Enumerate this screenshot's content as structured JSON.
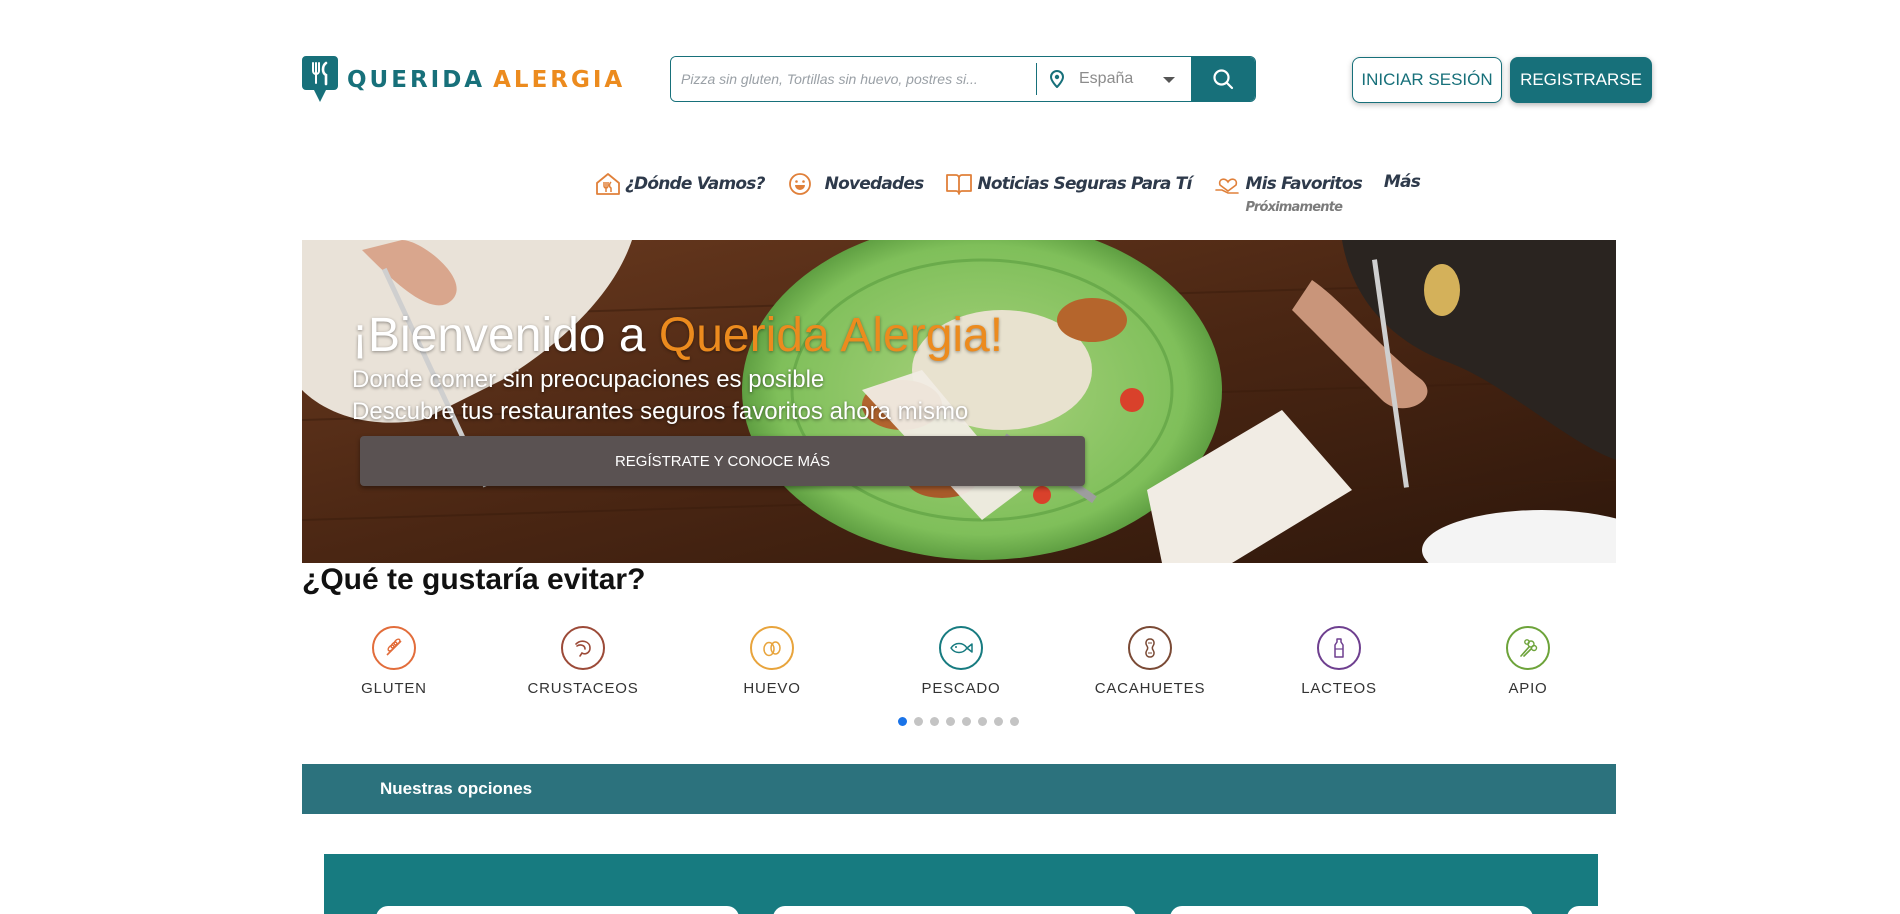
{
  "header": {
    "logo": {
      "part1": "QUERIDA",
      "part2": "ALERGIA"
    },
    "search": {
      "placeholder": "Pizza sin gluten, Tortillas sin huevo, postres si...",
      "location": "España"
    },
    "login_label": "INICIAR SESIÓN",
    "register_label": "REGISTRARSE"
  },
  "nav": {
    "items": [
      {
        "label": "¿Dónde Vamos?",
        "icon": "restaurant-house-icon"
      },
      {
        "label": "Novedades",
        "icon": "smiley-icon"
      },
      {
        "label": "Noticias Seguras Para Tí",
        "icon": "open-book-icon"
      },
      {
        "label": "Mis Favoritos",
        "icon": "heart-hand-icon",
        "sub": "Próximamente"
      },
      {
        "label": "Más"
      }
    ]
  },
  "hero": {
    "title_prefix": "¡Bienvenido a ",
    "title_accent": "Querida Alergia!",
    "line1": "Donde comer sin preocupaciones es posible",
    "line2": "Descubre tus restaurantes seguros favoritos ahora mismo",
    "cta": "REGÍSTRATE Y CONOCE MÁS"
  },
  "avoid": {
    "title": "¿Qué te gustaría evitar?",
    "items": [
      {
        "label": "GLUTEN",
        "color": "#e26d3b",
        "icon": "wheat-icon"
      },
      {
        "label": "CRUSTACEOS",
        "color": "#9c4a38",
        "icon": "shrimp-icon"
      },
      {
        "label": "HUEVO",
        "color": "#e8a43c",
        "icon": "egg-icon"
      },
      {
        "label": "PESCADO",
        "color": "#177b80",
        "icon": "fish-icon"
      },
      {
        "label": "CACAHUETES",
        "color": "#7a4a35",
        "icon": "peanut-icon"
      },
      {
        "label": "LACTEOS",
        "color": "#6e3f8f",
        "icon": "milk-bottle-icon"
      },
      {
        "label": "APIO",
        "color": "#6da33a",
        "icon": "celery-icon"
      }
    ],
    "carousel_pages": 8,
    "carousel_active": 1
  },
  "options": {
    "title": "Nuestras opciones"
  },
  "colors": {
    "brand_teal": "#17707a",
    "brand_orange": "#ec8b1e",
    "options_bar": "#2c727d",
    "options_panel": "#177b80"
  }
}
